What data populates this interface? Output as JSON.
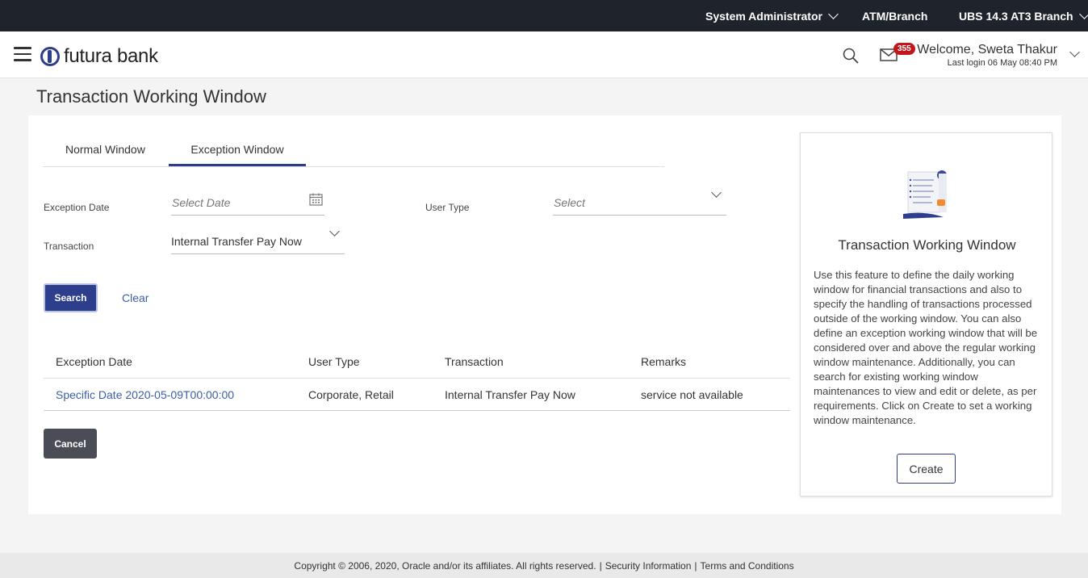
{
  "topbar": {
    "role": "System Administrator",
    "entity": "ATM/Branch",
    "branch": "UBS 14.3 AT3 Branch"
  },
  "header": {
    "logo_text": "futura bank",
    "mail_count": "355",
    "welcome": "Welcome, Sweta Thakur",
    "last_login": "Last login 06 May 08:40 PM"
  },
  "page": {
    "title": "Transaction Working Window"
  },
  "tabs": [
    {
      "label": "Normal Window",
      "active": false
    },
    {
      "label": "Exception Window",
      "active": true
    }
  ],
  "form": {
    "exception_date_label": "Exception Date",
    "exception_date_placeholder": "Select Date",
    "user_type_label": "User Type",
    "user_type_placeholder": "Select",
    "transaction_label": "Transaction",
    "transaction_value": "Internal Transfer Pay Now",
    "search_label": "Search",
    "clear_label": "Clear"
  },
  "table": {
    "headers": [
      "Exception Date",
      "User Type",
      "Transaction",
      "Remarks"
    ],
    "rows": [
      [
        "Specific Date 2020-05-09T00:00:00",
        "Corporate, Retail",
        "Internal Transfer Pay Now",
        "service not available"
      ]
    ]
  },
  "cancel_label": "Cancel",
  "help": {
    "title": "Transaction Working Window",
    "text": "Use this feature to define the daily working window for financial transactions and also to specify the handling of transactions processed outside of the working window. You can also define an exception working window that will be considered over and above the regular working window maintenance. Additionally, you can search for existing working window maintenances to view and edit or delete, as per requirements. Click on Create to set a working window maintenance.",
    "create_label": "Create"
  },
  "footer": {
    "copyright": "Copyright © 2006, 2020, Oracle and/or its affiliates. All rights reserved.",
    "sep": "|",
    "security": "Security Information",
    "terms": "Terms and Conditions"
  },
  "colors": {
    "topbar_bg": "#1f232c",
    "primary": "#2d3e8c",
    "link": "#3b5ea8",
    "badge": "#c3161c"
  }
}
